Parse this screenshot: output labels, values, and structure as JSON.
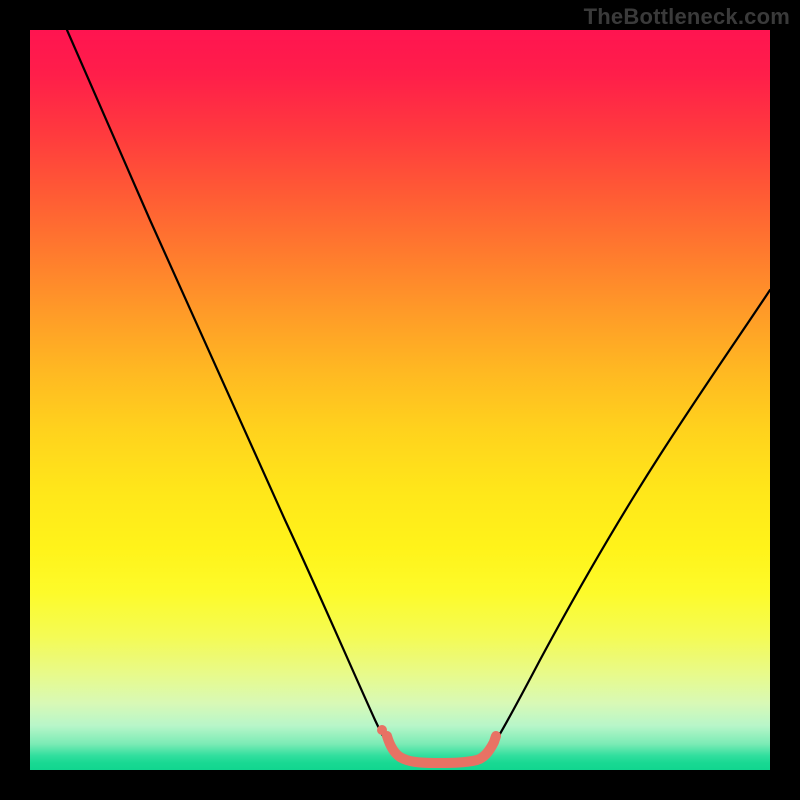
{
  "watermark": "TheBottleneck.com",
  "chart_data": {
    "type": "line",
    "title": "",
    "xlabel": "",
    "ylabel": "",
    "xlim": [
      0,
      100
    ],
    "ylim": [
      0,
      100
    ],
    "grid": false,
    "series": [
      {
        "name": "black-curve",
        "color": "#000000",
        "x": [
          5,
          10,
          15,
          20,
          25,
          30,
          35,
          40,
          45,
          48,
          50,
          52,
          55,
          58,
          62,
          66,
          70,
          75,
          80,
          85,
          90,
          95,
          100
        ],
        "values": [
          100,
          89,
          77,
          65,
          53,
          41,
          30,
          20,
          10,
          5,
          3,
          2,
          2,
          2,
          3,
          6,
          10,
          16,
          23,
          31,
          40,
          49,
          58
        ]
      },
      {
        "name": "salmon-overlay",
        "color": "#e87264",
        "x": [
          48,
          50,
          52,
          55,
          58,
          60,
          61,
          62
        ],
        "values": [
          5,
          3,
          2,
          2,
          2,
          2,
          3,
          6
        ]
      }
    ],
    "gradient_stops": [
      {
        "pos": 0,
        "color": "#ff1450"
      },
      {
        "pos": 50,
        "color": "#ffd21d"
      },
      {
        "pos": 92,
        "color": "#f0fba0"
      },
      {
        "pos": 100,
        "color": "#11d68f"
      }
    ]
  }
}
